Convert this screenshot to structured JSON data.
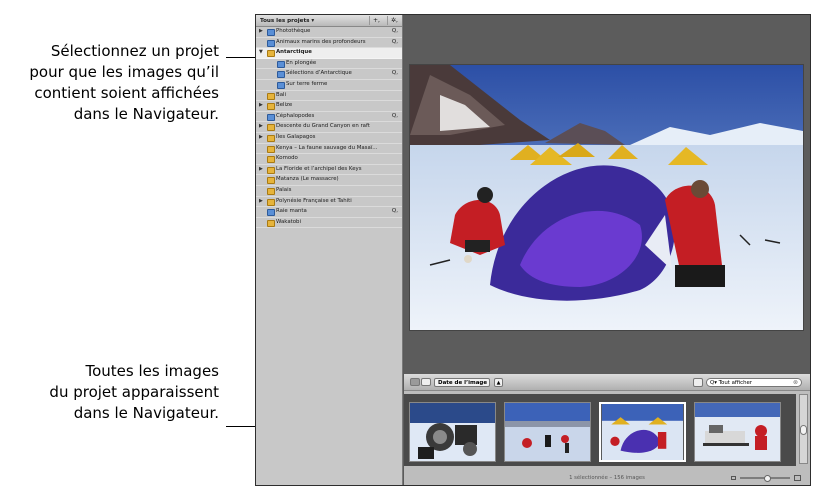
{
  "callouts": {
    "top": [
      "Sélectionnez un projet",
      "pour que les images qu’il",
      "contient soient affichées",
      "dans le Navigateur."
    ],
    "bottom": [
      "Toutes les images",
      "du projet apparaissent",
      "dans le Navigateur."
    ]
  },
  "projects_panel": {
    "title": "Tous les projets ▾",
    "add_button": "+,",
    "action_button": "✲,",
    "items": [
      {
        "label": "Photothèque",
        "icon": "photo-library-icon",
        "expand": "▶",
        "quick": "Q,"
      },
      {
        "label": "Animaux marins des profondeurs",
        "icon": "album-icon",
        "expand": "",
        "quick": "Q,"
      },
      {
        "label": "Antarctique",
        "icon": "folder-icon",
        "expand": "▼",
        "quick": ""
      },
      {
        "label": "En plongée",
        "icon": "album-icon",
        "expand": "",
        "quick": ""
      },
      {
        "label": "Sélections d’Antarctique",
        "icon": "album-icon",
        "expand": "",
        "quick": "Q,"
      },
      {
        "label": "Sur terre ferme",
        "icon": "album-icon",
        "expand": "",
        "quick": ""
      },
      {
        "label": "Bali",
        "icon": "folder-icon",
        "expand": "",
        "quick": ""
      },
      {
        "label": "Belize",
        "icon": "folder-icon",
        "expand": "▶",
        "quick": ""
      },
      {
        "label": "Céphalopodes",
        "icon": "album-icon",
        "expand": "",
        "quick": "Q,"
      },
      {
        "label": "Descente du Grand Canyon en raft",
        "icon": "folder-icon",
        "expand": "▶",
        "quick": ""
      },
      {
        "label": "Îles Galapagos",
        "icon": "folder-icon",
        "expand": "▶",
        "quick": ""
      },
      {
        "label": "Kenya – La faune sauvage du Masaï...",
        "icon": "folder-icon",
        "expand": "",
        "quick": ""
      },
      {
        "label": "Komodo",
        "icon": "folder-icon",
        "expand": "",
        "quick": ""
      },
      {
        "label": "La Floride et l’archipel des Keys",
        "icon": "folder-icon",
        "expand": "▶",
        "quick": ""
      },
      {
        "label": "Matanza (Le massacre)",
        "icon": "folder-icon",
        "expand": "",
        "quick": ""
      },
      {
        "label": "Palais",
        "icon": "folder-icon",
        "expand": "",
        "quick": ""
      },
      {
        "label": "Polynésie Française et Tahiti",
        "icon": "folder-icon",
        "expand": "▶",
        "quick": ""
      },
      {
        "label": "Raie manta",
        "icon": "album-icon",
        "expand": "",
        "quick": "Q,"
      },
      {
        "label": "Wakatobi",
        "icon": "folder-icon",
        "expand": "",
        "quick": ""
      }
    ],
    "selected_index": 2
  },
  "browser": {
    "sort_label": "Date de l’image",
    "sort_arrow": "▲",
    "search_placeholder": "Tout afficher",
    "search_prefix": "Q▾",
    "status": "1 sélectionnée – 156 images",
    "selected_thumb": 2
  },
  "colors": {
    "sky": "#3c62b8",
    "tent": "#e0b020",
    "parka": "#c41e24"
  }
}
